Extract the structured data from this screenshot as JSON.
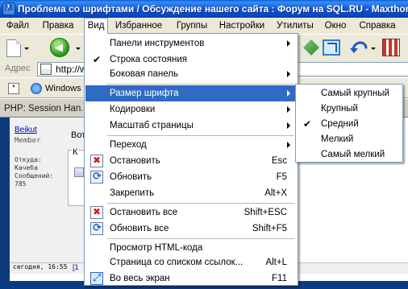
{
  "window": {
    "title": "Проблема со шрифтами / Обсуждение нашего сайта : Форум на SQL.RU - Maxthon Bro"
  },
  "menubar": {
    "items": [
      {
        "label": "Файл"
      },
      {
        "label": "Правка"
      },
      {
        "label": "Вид"
      },
      {
        "label": "Избранное"
      },
      {
        "label": "Группы"
      },
      {
        "label": "Настройки"
      },
      {
        "label": "Утилиты"
      },
      {
        "label": "Окно"
      },
      {
        "label": "Справка"
      }
    ],
    "active": "Вид"
  },
  "address": {
    "label": "Адрес",
    "value": "http://w"
  },
  "links": {
    "windows": "Windows"
  },
  "tab": {
    "label": "PHP: Session Han..."
  },
  "page": {
    "author": "Beikut",
    "role": "Member",
    "from_label": "Откуда:",
    "from_value": "Качеба",
    "posts_label": "Сообщений:",
    "posts_value": "785",
    "vot": "Вот",
    "k": "К",
    "date": "сегодня, 16:55",
    "foot_link": "[1"
  },
  "view_menu": {
    "items": [
      {
        "label": "Панели инструментов",
        "submenu": true
      },
      {
        "label": "Строка состояния",
        "checked": true
      },
      {
        "label": "Боковая панель",
        "submenu": true
      },
      {
        "label": "Размер шрифта",
        "submenu": true,
        "highlighted": true
      },
      {
        "label": "Кодировки",
        "submenu": true
      },
      {
        "label": "Масштаб страницы",
        "submenu": true
      },
      {
        "label": "Переход",
        "submenu": true
      },
      {
        "label": "Остановить",
        "shortcut": "Esc",
        "icon": "stop-icon"
      },
      {
        "label": "Обновить",
        "shortcut": "F5",
        "icon": "refresh-icon"
      },
      {
        "label": "Закрепить",
        "shortcut": "Alt+X"
      },
      {
        "label": "Остановить все",
        "shortcut": "Shift+ESC",
        "icon": "stop-all-icon"
      },
      {
        "label": "Обновить все",
        "shortcut": "Shift+F5",
        "icon": "refresh-all-icon"
      },
      {
        "label": "Просмотр HTML-кода"
      },
      {
        "label": "Страница со списком ссылок...",
        "shortcut": "Alt+L"
      },
      {
        "label": "Во весь экран",
        "shortcut": "F11",
        "icon": "fullscreen-icon"
      }
    ]
  },
  "font_size_menu": {
    "items": [
      {
        "label": "Самый крупный"
      },
      {
        "label": "Крупный"
      },
      {
        "label": "Средний",
        "checked": true
      },
      {
        "label": "Мелкий"
      },
      {
        "label": "Самый мелкий"
      }
    ]
  },
  "colors": {
    "highlight": "#316ac5",
    "titlebar": "#0a5fd8"
  }
}
